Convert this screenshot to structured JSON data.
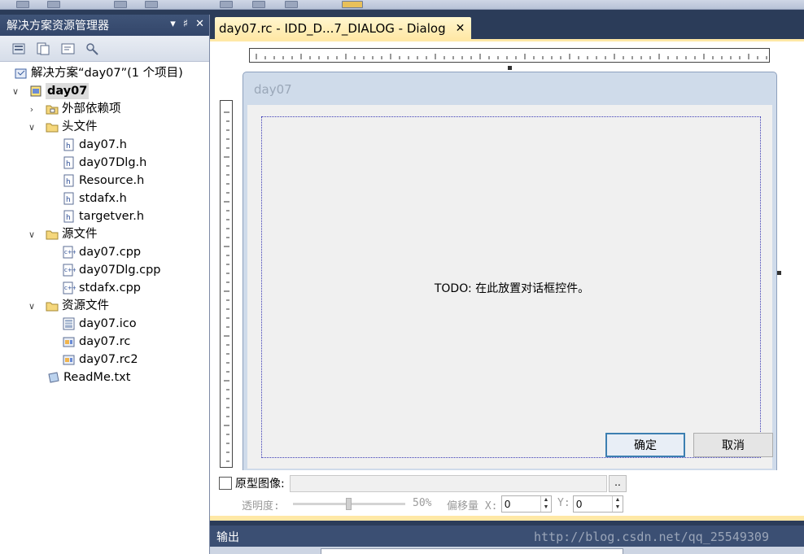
{
  "solution_explorer": {
    "title": "解决方案资源管理器",
    "header_buttons": [
      "▾",
      "♯",
      "✕"
    ],
    "tree": [
      {
        "label": "解决方案“day07”(1 个项目)",
        "icon": "solution-icon",
        "indent": 0,
        "arrow": ""
      },
      {
        "label": "day07",
        "icon": "project-icon",
        "indent": 0,
        "arrow": "∨",
        "selected": true
      },
      {
        "label": "外部依赖项",
        "icon": "external-deps-icon",
        "indent": 1,
        "arrow": "›"
      },
      {
        "label": "头文件",
        "icon": "folder-icon",
        "indent": 1,
        "arrow": "∨"
      },
      {
        "label": "day07.h",
        "icon": "header-file-icon",
        "indent": 2,
        "arrow": ""
      },
      {
        "label": "day07Dlg.h",
        "icon": "header-file-icon",
        "indent": 2,
        "arrow": ""
      },
      {
        "label": "Resource.h",
        "icon": "header-file-icon",
        "indent": 2,
        "arrow": ""
      },
      {
        "label": "stdafx.h",
        "icon": "header-file-icon",
        "indent": 2,
        "arrow": ""
      },
      {
        "label": "targetver.h",
        "icon": "header-file-icon",
        "indent": 2,
        "arrow": ""
      },
      {
        "label": "源文件",
        "icon": "folder-icon",
        "indent": 1,
        "arrow": "∨"
      },
      {
        "label": "day07.cpp",
        "icon": "cpp-file-icon",
        "indent": 2,
        "arrow": ""
      },
      {
        "label": "day07Dlg.cpp",
        "icon": "cpp-file-icon",
        "indent": 2,
        "arrow": ""
      },
      {
        "label": "stdafx.cpp",
        "icon": "cpp-file-icon",
        "indent": 2,
        "arrow": ""
      },
      {
        "label": "资源文件",
        "icon": "folder-icon",
        "indent": 1,
        "arrow": "∨"
      },
      {
        "label": "day07.ico",
        "icon": "ico-file-icon",
        "indent": 2,
        "arrow": ""
      },
      {
        "label": "day07.rc",
        "icon": "rc-file-icon",
        "indent": 2,
        "arrow": ""
      },
      {
        "label": "day07.rc2",
        "icon": "rc-file-icon",
        "indent": 2,
        "arrow": ""
      },
      {
        "label": "ReadMe.txt",
        "icon": "txt-file-icon",
        "indent": 1,
        "arrow": ""
      }
    ]
  },
  "document_tab": {
    "label": "day07.rc - IDD_D...7_DIALOG - Dialog",
    "close": "✕"
  },
  "dialog": {
    "title": "day07",
    "todo_text": "TODO: 在此放置对话框控件。",
    "ok_label": "确定",
    "cancel_label": "取消"
  },
  "prototype": {
    "image_label": "原型图像:",
    "browse_label": "..",
    "transparency_label": "透明度:",
    "transparency_value": "50%",
    "transparency_fraction": 0.5,
    "offset_label": "偏移量 X:",
    "x_value": "0",
    "y_label": "Y:",
    "y_value": "0"
  },
  "output": {
    "title": "输出"
  },
  "watermark": "http://blog.csdn.net/qq_25549309",
  "colors": {
    "panel_header": "#3f5478",
    "active_tab": "#ffe8a6",
    "dialog_frame": "#cfdbea"
  }
}
